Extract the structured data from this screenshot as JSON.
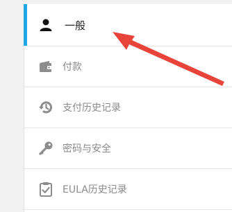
{
  "colors": {
    "accent": "#1ea7e6",
    "annotation_arrow": "#e8443a",
    "active_icon": "#111111",
    "inactive_icon": "#8c8c8c"
  },
  "menu": {
    "items": [
      {
        "label": "一般",
        "icon": "user-icon",
        "active": true
      },
      {
        "label": "付款",
        "icon": "wallet-icon",
        "active": false
      },
      {
        "label": "支付历史记录",
        "icon": "history-icon",
        "active": false
      },
      {
        "label": "密码与安全",
        "icon": "key-icon",
        "active": false
      },
      {
        "label": "EULA历史记录",
        "icon": "clipboard-check-icon",
        "active": false
      }
    ]
  }
}
